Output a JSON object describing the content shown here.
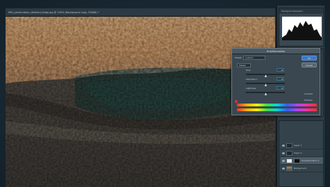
{
  "document": {
    "title": "IMG_preservation_detailed_ledge.jpg @ 100% (Background copy, RGB/8) *"
  },
  "histogram_panel": {
    "tabs": "Histogram  Navigator"
  },
  "dialog": {
    "title": "Hue/Saturation",
    "preset_label": "Preset:",
    "preset_value": "Custom",
    "channel_value": "Master",
    "hue_label": "Hue:",
    "hue_value": "0",
    "saturation_label": "Saturation:",
    "saturation_value": "0",
    "lightness_label": "Lightness:",
    "lightness_value": "0",
    "ok_label": "OK",
    "cancel_label": "Cancel",
    "colorize_label": "Colorize",
    "preview_label": "Preview"
  },
  "layers": [
    {
      "name": "Layer 1",
      "thumb": "plain"
    },
    {
      "name": "Layer 2",
      "thumb": "plain"
    },
    {
      "name": "Hue/Saturation 1",
      "thumb": "mask"
    },
    {
      "name": "Background",
      "thumb": "photo"
    }
  ],
  "colors": {
    "accent": "#3d78c9",
    "panel": "#34424b"
  }
}
